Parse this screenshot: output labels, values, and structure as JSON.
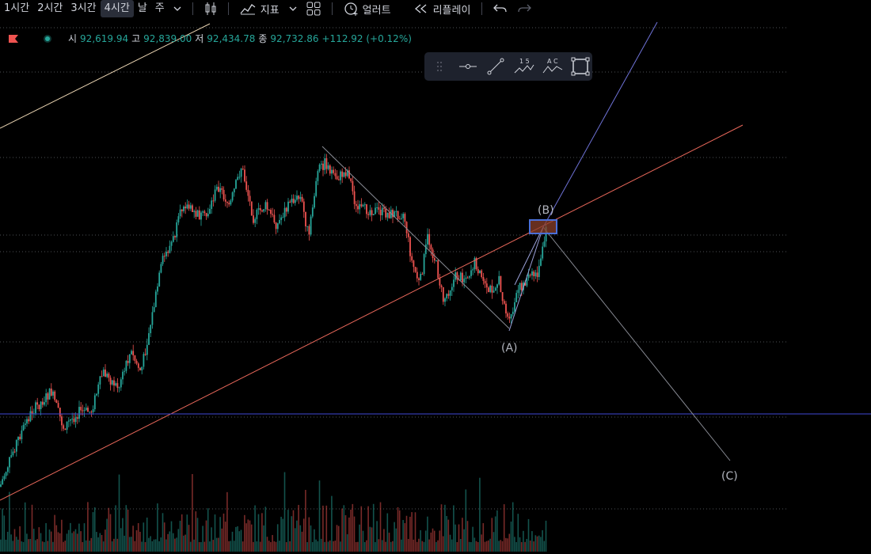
{
  "toolbar": {
    "timeframes": [
      "1시간",
      "2시간",
      "3시간",
      "4시간",
      "날",
      "주"
    ],
    "active_timeframe": "4시간",
    "indicators_label": "지표",
    "alert_label": "얼러트",
    "replay_label": "리플레이"
  },
  "ohlc": {
    "open_label": "시",
    "open": "92,619.94",
    "high_label": "고",
    "high": "92,839.00",
    "low_label": "저",
    "low": "92,434.78",
    "close_label": "종",
    "close": "92,732.86",
    "change": "+112.92 (+0.12%)"
  },
  "drawing_tools": {
    "tool_3_top": "1 5",
    "tool_4_top": "A C"
  },
  "wave_labels": {
    "a": "(A)",
    "b": "(B)",
    "c": "(C)"
  },
  "colors": {
    "up": "#26a69a",
    "down": "#ef5350",
    "trendline_red": "#e8675a",
    "trendline_blue": "#6f73d8",
    "horizontal_blue": "#3f47d6",
    "highlight_box": "#4a6fd8",
    "highlight_fill": "#8a3f2a"
  }
}
